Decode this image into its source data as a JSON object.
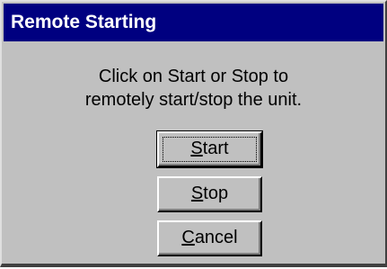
{
  "window": {
    "title": "Remote Starting"
  },
  "message": {
    "line1": "Click on Start or Stop to",
    "line2": "remotely start/stop the unit."
  },
  "buttons": {
    "start": {
      "label": "Start",
      "mnemonic": "S"
    },
    "stop": {
      "label": "Stop",
      "mnemonic": "S"
    },
    "cancel": {
      "label": "Cancel",
      "mnemonic": "C"
    }
  },
  "colors": {
    "titlebar": "#000080",
    "face": "#c0c0c0"
  }
}
